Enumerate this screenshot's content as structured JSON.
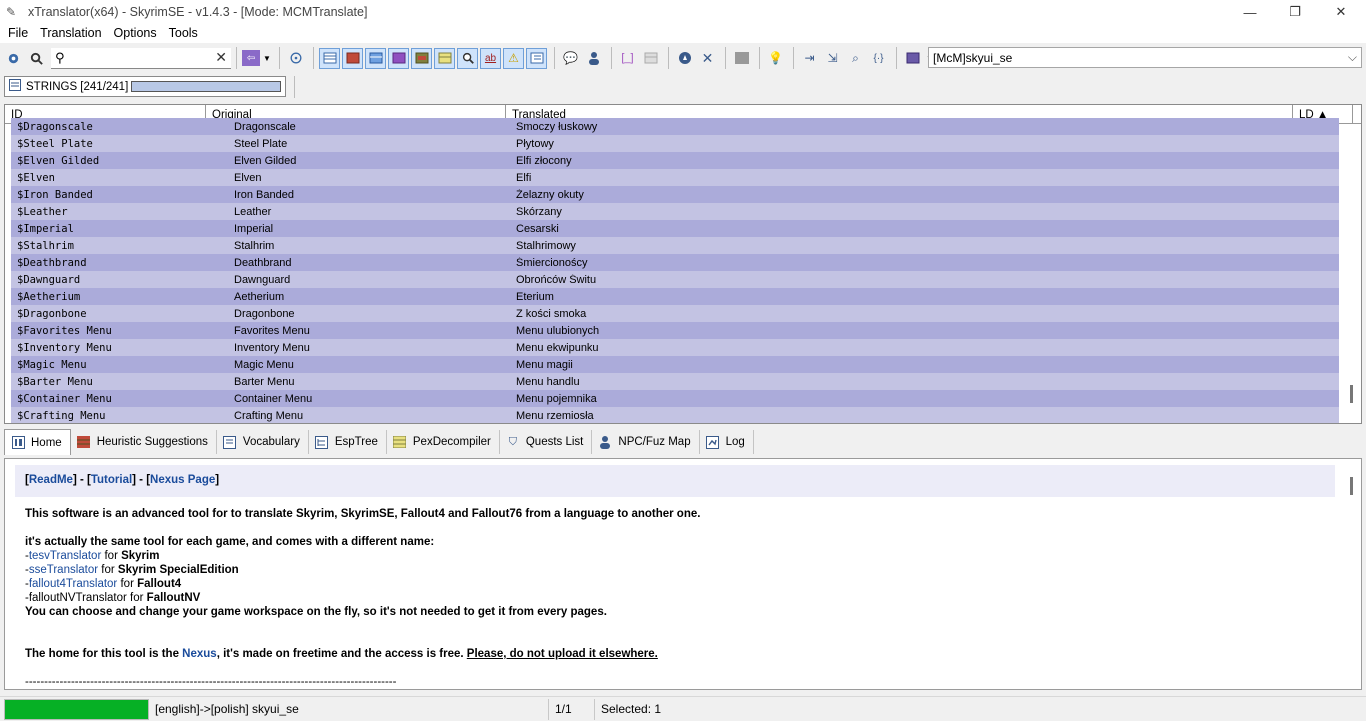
{
  "window": {
    "title": "xTranslator(x64) - SkyrimSE - v1.4.3 - [Mode: MCMTranslate]",
    "minimize_glyph": "—",
    "restore_glyph": "❐",
    "close_glyph": "✕"
  },
  "menu": [
    "File",
    "Translation",
    "Options",
    "Tools"
  ],
  "toolbar": {
    "search_value": "",
    "search_placeholder": "",
    "clear_glyph": "✕",
    "combo_value": "[McM]skyui_se",
    "combo_arrow": "⌵"
  },
  "strings_tab": {
    "label": "STRINGS [241/241]",
    "progress_fraction": 1.0
  },
  "grid": {
    "headers": [
      "ID",
      "Original",
      "Translated",
      "LD ▲"
    ],
    "rows": [
      {
        "id": "$Dragonscale",
        "original": "Dragonscale",
        "translated": "Smoczy łuskowy"
      },
      {
        "id": "$Steel Plate",
        "original": "Steel Plate",
        "translated": "Płytowy"
      },
      {
        "id": "$Elven Gilded",
        "original": "Elven Gilded",
        "translated": "Elfi złocony"
      },
      {
        "id": "$Elven",
        "original": "Elven",
        "translated": "Elfi"
      },
      {
        "id": "$Iron Banded",
        "original": "Iron Banded",
        "translated": "Żelazny okuty"
      },
      {
        "id": "$Leather",
        "original": "Leather",
        "translated": "Skórzany"
      },
      {
        "id": "$Imperial",
        "original": "Imperial",
        "translated": "Cesarski"
      },
      {
        "id": "$Stalhrim",
        "original": "Stalhrim",
        "translated": "Stalhrimowy"
      },
      {
        "id": "$Deathbrand",
        "original": "Deathbrand",
        "translated": "Śmiercionoścy"
      },
      {
        "id": "$Dawnguard",
        "original": "Dawnguard",
        "translated": "Obrońców Świtu"
      },
      {
        "id": "$Aetherium",
        "original": "Aetherium",
        "translated": "Eterium"
      },
      {
        "id": "$Dragonbone",
        "original": "Dragonbone",
        "translated": "Z kości smoka"
      },
      {
        "id": "$Favorites Menu",
        "original": "Favorites Menu",
        "translated": "Menu ulubionych"
      },
      {
        "id": "$Inventory Menu",
        "original": "Inventory Menu",
        "translated": "Menu ekwipunku"
      },
      {
        "id": "$Magic Menu",
        "original": "Magic Menu",
        "translated": "Menu magii"
      },
      {
        "id": "$Barter Menu",
        "original": "Barter Menu",
        "translated": "Menu handlu"
      },
      {
        "id": "$Container Menu",
        "original": "Container Menu",
        "translated": "Menu pojemnika"
      },
      {
        "id": "$Crafting Menu",
        "original": "Crafting Menu",
        "translated": "Menu rzemiosła"
      }
    ]
  },
  "tabs": [
    {
      "label": "Home",
      "icon": "home-icon"
    },
    {
      "label": "Heuristic Suggestions",
      "icon": "heuristic-icon"
    },
    {
      "label": "Vocabulary",
      "icon": "vocabulary-icon"
    },
    {
      "label": "EspTree",
      "icon": "esptree-icon"
    },
    {
      "label": "PexDecompiler",
      "icon": "pex-icon"
    },
    {
      "label": "Quests List",
      "icon": "quest-icon"
    },
    {
      "label": "NPC/Fuz Map",
      "icon": "npc-icon"
    },
    {
      "label": "Log",
      "icon": "log-icon"
    }
  ],
  "home": {
    "link_readme": "ReadMe",
    "link_tutorial": "Tutorial",
    "link_nexus_page": "Nexus Page",
    "intro": "This software is an advanced tool for to translate Skyrim, SkyrimSE, Fallout4 and Fallout76 from a language to another one.",
    "same_tool": "it's actually the same tool for each game, and comes with a different name:",
    "names": [
      {
        "tool": "tesvTranslator",
        "for": " for ",
        "game": "Skyrim"
      },
      {
        "tool": "sseTranslator",
        "for": " for ",
        "game": "Skyrim SpecialEdition"
      },
      {
        "tool": "fallout4Translator",
        "for": " for ",
        "game": "Fallout4"
      },
      {
        "tool": "falloutNVTranslator",
        "for": " for ",
        "game": "FalloutNV"
      }
    ],
    "workspace": "You can choose and change your game workspace on the fly, so it's not needed to get it from every pages.",
    "home_prefix": "The home for this tool is the ",
    "home_link": "Nexus",
    "home_middle": ", it's made on freetime and the access is free. ",
    "home_warning": "Please, do not upload it elsewhere.",
    "divider": "-------------------------------------------------------------------------------------------------"
  },
  "status": {
    "progress_fraction": 1.0,
    "langs": "[english]->[polish] skyui_se",
    "page": "1/1",
    "selected": "Selected: 1"
  },
  "colors": {
    "row_odd": "#c3c3e3",
    "row_even": "#ababda",
    "status_green": "#06b025",
    "link_blue": "#1a4b9b"
  }
}
